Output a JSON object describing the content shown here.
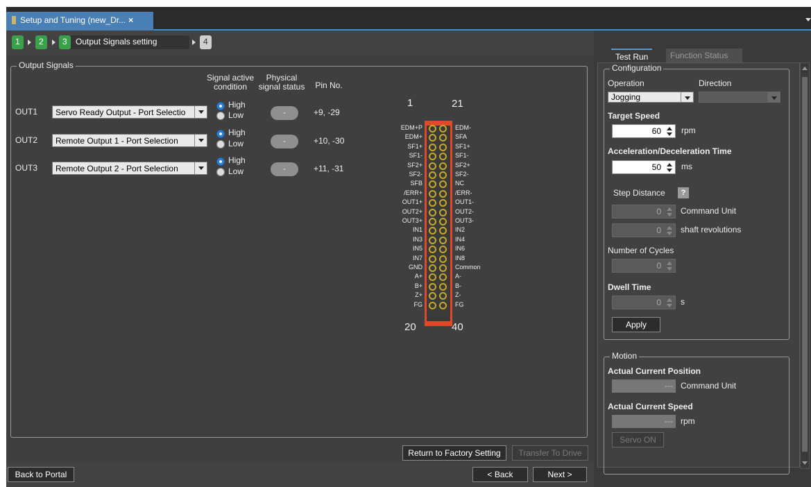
{
  "window": {
    "tab_title": "Setup and Tuning (new_Dr...",
    "tab_close": "×"
  },
  "steps": {
    "s1": "1",
    "s2": "2",
    "s3": "3",
    "s3_label": "Output Signals setting",
    "s4": "4"
  },
  "output_signals": {
    "group_title": "Output Signals",
    "col_signal_active": "Signal active condition",
    "col_physical": "Physical signal status",
    "col_pin": "Pin No.",
    "rows": [
      {
        "label": "OUT1",
        "selection": "Servo Ready Output - Port Selectio",
        "high": "High",
        "low": "Low",
        "status": "-",
        "pins": "+9, -29"
      },
      {
        "label": "OUT2",
        "selection": "Remote Output 1 - Port Selection",
        "high": "High",
        "low": "Low",
        "status": "-",
        "pins": "+10, -30"
      },
      {
        "label": "OUT3",
        "selection": "Remote Output 2 - Port Selection",
        "high": "High",
        "low": "Low",
        "status": "-",
        "pins": "+11, -31"
      }
    ]
  },
  "connector": {
    "top_left": "1",
    "top_right": "21",
    "bottom_left": "20",
    "bottom_right": "40",
    "left_pins": [
      "EDM+P",
      "EDM+",
      "SF1+",
      "SF1-",
      "SF2+",
      "SF2-",
      "SFB",
      "/ERR+",
      "OUT1+",
      "OUT2+",
      "OUT3+",
      "IN1",
      "IN3",
      "IN5",
      "IN7",
      "GND",
      "A+",
      "B+",
      "Z+",
      "FG"
    ],
    "right_pins": [
      "EDM-",
      "SFA",
      "SF1+",
      "SF1-",
      "SF2+",
      "SF2-",
      "NC",
      "/ERR-",
      "OUT1-",
      "OUT2-",
      "OUT3-",
      "IN2",
      "IN4",
      "IN6",
      "IN8",
      "Common",
      "A-",
      "B-",
      "Z-",
      "FG"
    ]
  },
  "buttons": {
    "factory": "Return to Factory Setting",
    "transfer": "Transfer To Drive",
    "back_portal": "Back to Portal",
    "back": "< Back",
    "next": "Next >"
  },
  "right": {
    "tab_test_run": "Test Run",
    "tab_function_status": "Function Status",
    "config_title": "Configuration",
    "operation_label": "Operation",
    "operation_value": "Jogging",
    "direction_label": "Direction",
    "target_speed_label": "Target Speed",
    "target_speed_value": "60",
    "target_speed_unit": "rpm",
    "accel_label": "Acceleration/Deceleration Time",
    "accel_value": "50",
    "accel_unit": "ms",
    "step_distance_label": "Step Distance",
    "help": "?",
    "step_cmd_value": "0",
    "step_cmd_unit": "Command Unit",
    "step_rev_value": "0",
    "step_rev_unit": "shaft revolutions",
    "cycles_label": "Number of Cycles",
    "cycles_value": "0",
    "dwell_label": "Dwell Time",
    "dwell_value": "0",
    "dwell_unit": "s",
    "apply": "Apply",
    "motion_title": "Motion",
    "pos_label": "Actual Current Position",
    "pos_value": "---",
    "pos_unit": "Command Unit",
    "speed_label": "Actual Current Speed",
    "speed_value": "---",
    "speed_unit": "rpm",
    "servo_on": "Servo ON"
  }
}
